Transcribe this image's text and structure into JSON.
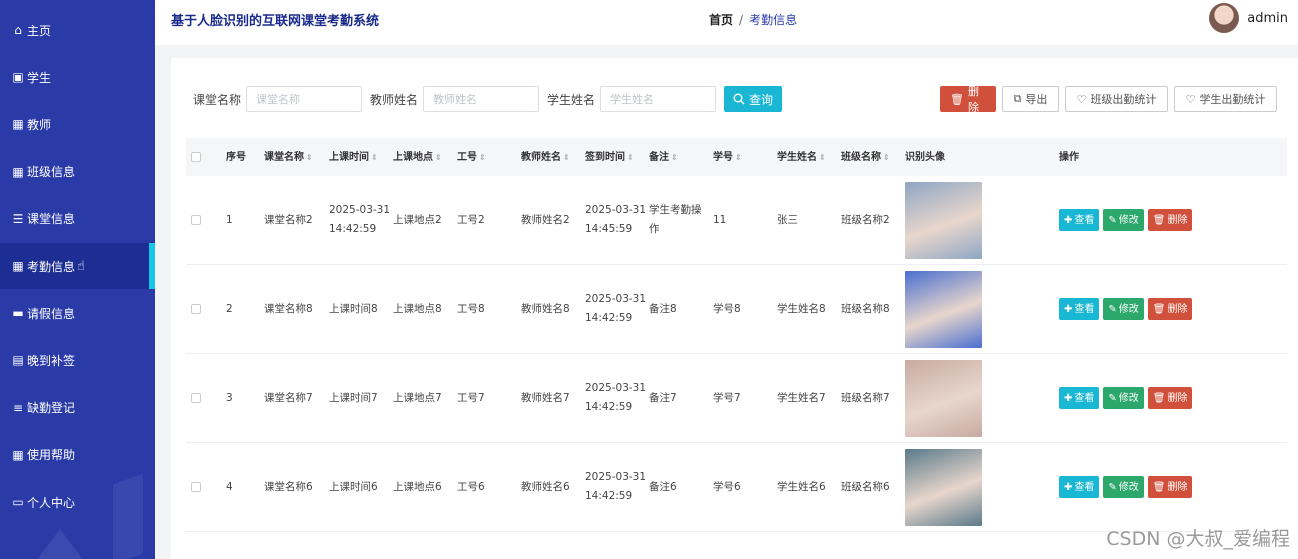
{
  "sidebar": {
    "items": [
      {
        "label": "主页",
        "icon": "home-icon",
        "glyph": "⌂"
      },
      {
        "label": "学生",
        "icon": "clipboard-icon",
        "glyph": "▣"
      },
      {
        "label": "教师",
        "icon": "grid-icon",
        "glyph": "▦"
      },
      {
        "label": "班级信息",
        "icon": "apps-icon",
        "glyph": "▦"
      },
      {
        "label": "课堂信息",
        "icon": "sliders-icon",
        "glyph": "☰"
      },
      {
        "label": "考勤信息",
        "icon": "apps-icon",
        "glyph": "▦",
        "active": true
      },
      {
        "label": "请假信息",
        "icon": "monitor-icon",
        "glyph": "▬"
      },
      {
        "label": "晚到补签",
        "icon": "document-icon",
        "glyph": "▤"
      },
      {
        "label": "缺勤登记",
        "icon": "list-icon",
        "glyph": "≡"
      },
      {
        "label": "使用帮助",
        "icon": "apps-icon",
        "glyph": "▦"
      },
      {
        "label": "个人中心",
        "icon": "id-card-icon",
        "glyph": "▭"
      }
    ]
  },
  "header": {
    "title": "基于人脸识别的互联网课堂考勤系统",
    "breadcrumb_home": "首页",
    "breadcrumb_sep": "/",
    "breadcrumb_current": "考勤信息",
    "username": "admin"
  },
  "search": {
    "course_label": "课堂名称",
    "course_placeholder": "课堂名称",
    "teacher_label": "教师姓名",
    "teacher_placeholder": "教师姓名",
    "student_label": "学生姓名",
    "student_placeholder": "学生姓名",
    "query_label": "查询"
  },
  "actions": {
    "delete": "删除",
    "export": "导出",
    "class_stats": "班级出勤统计",
    "student_stats": "学生出勤统计"
  },
  "table": {
    "headers": {
      "no": "序号",
      "course": "课堂名称",
      "time": "上课时间",
      "place": "上课地点",
      "job_no": "工号",
      "teacher": "教师姓名",
      "sign_time": "签到时间",
      "note": "备注",
      "stu_no": "学号",
      "stu_name": "学生姓名",
      "class": "班级名称",
      "photo": "识别头像",
      "ops": "操作"
    },
    "rows": [
      {
        "no": "1",
        "course": "课堂名称2",
        "time1": "2025-03-31",
        "time2": "14:42:59",
        "place": "上课地点2",
        "job_no": "工号2",
        "teacher": "教师姓名2",
        "sign1": "2025-03-31",
        "sign2": "14:45:59",
        "note1": "学生考勤操",
        "note2": "作",
        "stu_no": "11",
        "stu_name": "张三",
        "class": "班级名称2",
        "photo_color": "#8fa6c4"
      },
      {
        "no": "2",
        "course": "课堂名称8",
        "time1": "上课时间8",
        "time2": "",
        "place": "上课地点8",
        "job_no": "工号8",
        "teacher": "教师姓名8",
        "sign1": "2025-03-31",
        "sign2": "14:42:59",
        "note1": "备注8",
        "note2": "",
        "stu_no": "学号8",
        "stu_name": "学生姓名8",
        "class": "班级名称8",
        "photo_color": "#4a6fd0"
      },
      {
        "no": "3",
        "course": "课堂名称7",
        "time1": "上课时间7",
        "time2": "",
        "place": "上课地点7",
        "job_no": "工号7",
        "teacher": "教师姓名7",
        "sign1": "2025-03-31",
        "sign2": "14:42:59",
        "note1": "备注7",
        "note2": "",
        "stu_no": "学号7",
        "stu_name": "学生姓名7",
        "class": "班级名称7",
        "photo_color": "#c7aaa2"
      },
      {
        "no": "4",
        "course": "课堂名称6",
        "time1": "上课时间6",
        "time2": "",
        "place": "上课地点6",
        "job_no": "工号6",
        "teacher": "教师姓名6",
        "sign1": "2025-03-31",
        "sign2": "14:42:59",
        "note1": "备注6",
        "note2": "",
        "stu_no": "学号6",
        "stu_name": "学生姓名6",
        "class": "班级名称6",
        "photo_color": "#5a7a8a"
      }
    ],
    "op_view": "查看",
    "op_edit": "修改",
    "op_delete": "删除"
  },
  "watermark": "CSDN @大叔_爱编程"
}
